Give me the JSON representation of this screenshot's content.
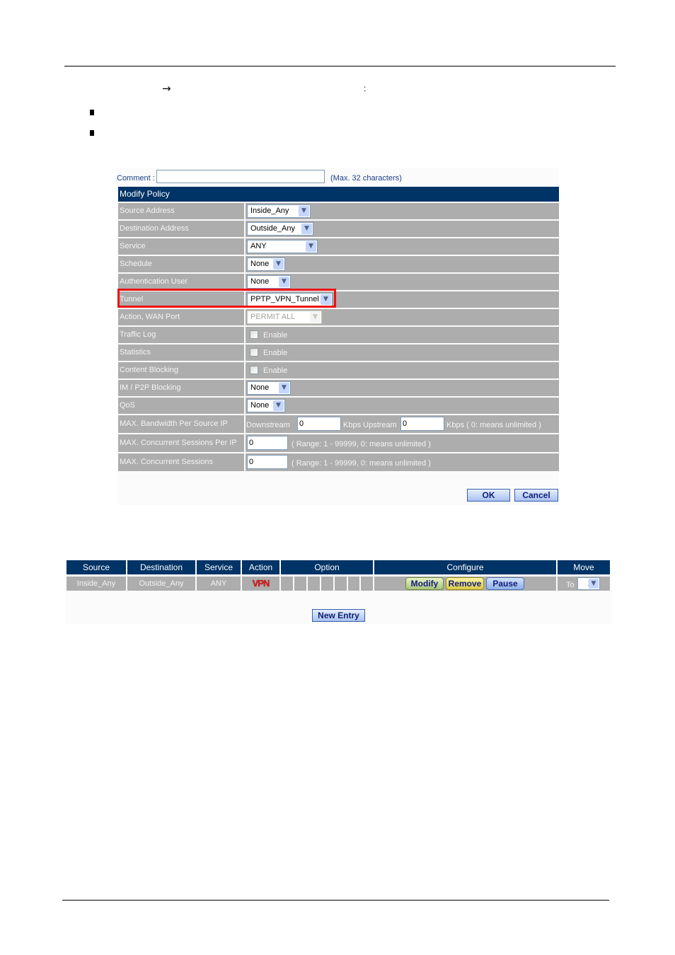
{
  "document": {
    "arrow_glyph": "→",
    "colon": ":",
    "bullets": [
      "",
      ""
    ]
  },
  "form": {
    "comment_label": "Comment :",
    "comment_value": "",
    "comment_hint": "(Max. 32 characters)",
    "title": "Modify Policy",
    "rows": {
      "source_address": {
        "label": "Source Address",
        "value": "Inside_Any"
      },
      "destination_address": {
        "label": "Destination Address",
        "value": "Outside_Any"
      },
      "service": {
        "label": "Service",
        "value": "ANY"
      },
      "schedule": {
        "label": "Schedule",
        "value": "None"
      },
      "authentication_user": {
        "label": "Authentication User",
        "value": "None"
      },
      "tunnel": {
        "label": "Tunnel",
        "value": "PPTP_VPN_Tunnel"
      },
      "action_wan_port": {
        "label": "Action, WAN Port",
        "value": "PERMIT ALL"
      },
      "traffic_log": {
        "label": "Traffic Log",
        "checkbox_label": "Enable",
        "checked": false
      },
      "statistics": {
        "label": "Statistics",
        "checkbox_label": "Enable",
        "checked": false
      },
      "content_blocking": {
        "label": "Content Blocking",
        "checkbox_label": "Enable",
        "checked": false
      },
      "im_p2p_blocking": {
        "label": "IM / P2P Blocking",
        "value": "None"
      },
      "qos": {
        "label": "QoS",
        "value": "None"
      },
      "max_bandwidth": {
        "label": "MAX. Bandwidth Per Source IP",
        "downstream_label": "Downstream",
        "downstream_value": "0",
        "upstream_label": "Kbps Upstream",
        "upstream_value": "0",
        "hint": "Kbps ( 0: means unlimited )"
      },
      "max_sessions_per_ip": {
        "label": "MAX. Concurrent Sessions Per IP",
        "value": "0",
        "hint": "( Range: 1 - 99999, 0: means unlimited )"
      },
      "max_sessions": {
        "label": "MAX. Concurrent Sessions",
        "value": "0",
        "hint": "( Range: 1 - 99999, 0: means unlimited )"
      }
    },
    "ok_label": "OK",
    "cancel_label": "Cancel"
  },
  "policy_table": {
    "headers": [
      "Source",
      "Destination",
      "Service",
      "Action",
      "Option",
      "Configure",
      "Move"
    ],
    "rows": [
      {
        "source": "Inside_Any",
        "destination": "Outside_Any",
        "service": "ANY",
        "action": "VPN",
        "options": [
          "",
          "",
          "",
          "",
          "",
          "",
          ""
        ],
        "configure": {
          "modify": "Modify",
          "remove": "Remove",
          "pause": "Pause"
        },
        "move_label": "To",
        "move_value": "1"
      }
    ],
    "new_entry_label": "New Entry"
  },
  "colors": {
    "header_bg": "#003366",
    "row_bg": "#adadad",
    "highlight_border": "#ee1111",
    "action_vpn": "#d41d1d"
  }
}
